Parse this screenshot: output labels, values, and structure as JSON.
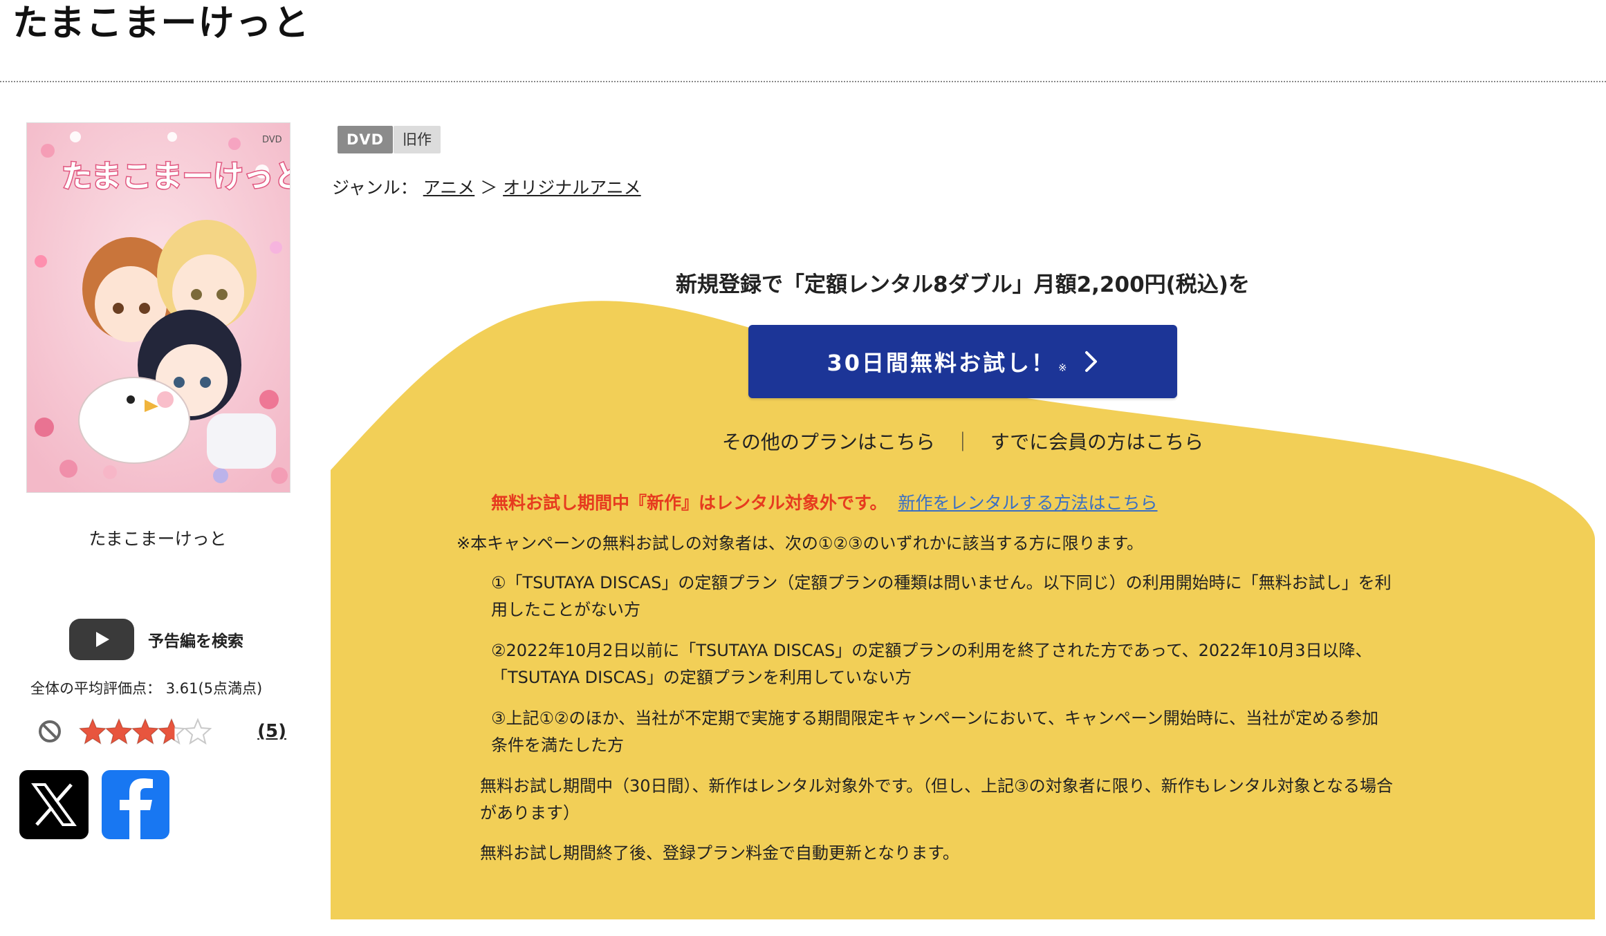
{
  "title": "たまこまーけっと",
  "product": {
    "cover_caption": "たまこまーけっと",
    "cover_art": {
      "title_text": "たまこまーけっと",
      "format_mark": "DVD",
      "colors": {
        "background": "#f6c8d2",
        "title": "#ffffff",
        "title_outline": "#e0567f"
      }
    },
    "trailer_label": "予告編を検索",
    "rating": {
      "label": "全体の平均評価点：",
      "score": "3.61(5点満点)",
      "stars_value": 3.61,
      "stars_max": 5,
      "review_count": "(5)",
      "star_color": "#e8553e"
    }
  },
  "share": {
    "x_icon": "x-logo-icon",
    "facebook_icon": "facebook-logo-icon"
  },
  "badges": {
    "format": "DVD",
    "status": "旧作"
  },
  "genre": {
    "label": "ジャンル：",
    "main": "アニメ",
    "separator": "＞",
    "sub": "オリジナルアニメ"
  },
  "promo": {
    "heading": "新規登録で「定額レンタル8ダブル」月額2,200円(税込)を",
    "cta_label": "30日間無料お試し！",
    "cta_note": "※",
    "other_plans": "その他のプランはこちら",
    "links_separator": "｜",
    "member_login": "すでに会員の方はこちら",
    "notice_red": "無料お試し期間中『新作』はレンタル対象外です。",
    "notice_link": "新作をレンタルする方法はこちら",
    "campaign_note": "※本キャンペーンの無料お試しの対象者は、次の①②③のいずれかに該当する方に限ります。",
    "conditions": [
      {
        "line1": "①「TSUTAYA DISCAS」の定額プラン（定額プランの種類は問いません。以下同じ）の利用開始時に「無料お試し」を利",
        "line2": "用したことがない方"
      },
      {
        "line1": "②2022年10月2日以前に「TSUTAYA DISCAS」の定額プランの利用を終了された方であって、2022年10月3日以降、",
        "line2": "「TSUTAYA DISCAS」の定額プランを利用していない方"
      },
      {
        "line1": "③上記①②のほか、当社が不定期で実施する期間限定キャンペーンにおいて、キャンペーン開始時に、当社が定める参加",
        "line2": "条件を満たした方"
      }
    ],
    "trial_note_line1": "無料お試し期間中（30日間）、新作はレンタル対象外です。（但し、上記③の対象者に限り、新作もレンタル対象となる場合",
    "trial_note_line2": "があります）",
    "renewal_note": "無料お試し期間終了後、登録プラン料金で自動更新となります。",
    "colors": {
      "background": "#f2cf57",
      "button": "#1c3597",
      "notice_red": "#e63b1f",
      "link": "#3a6fc4"
    }
  }
}
